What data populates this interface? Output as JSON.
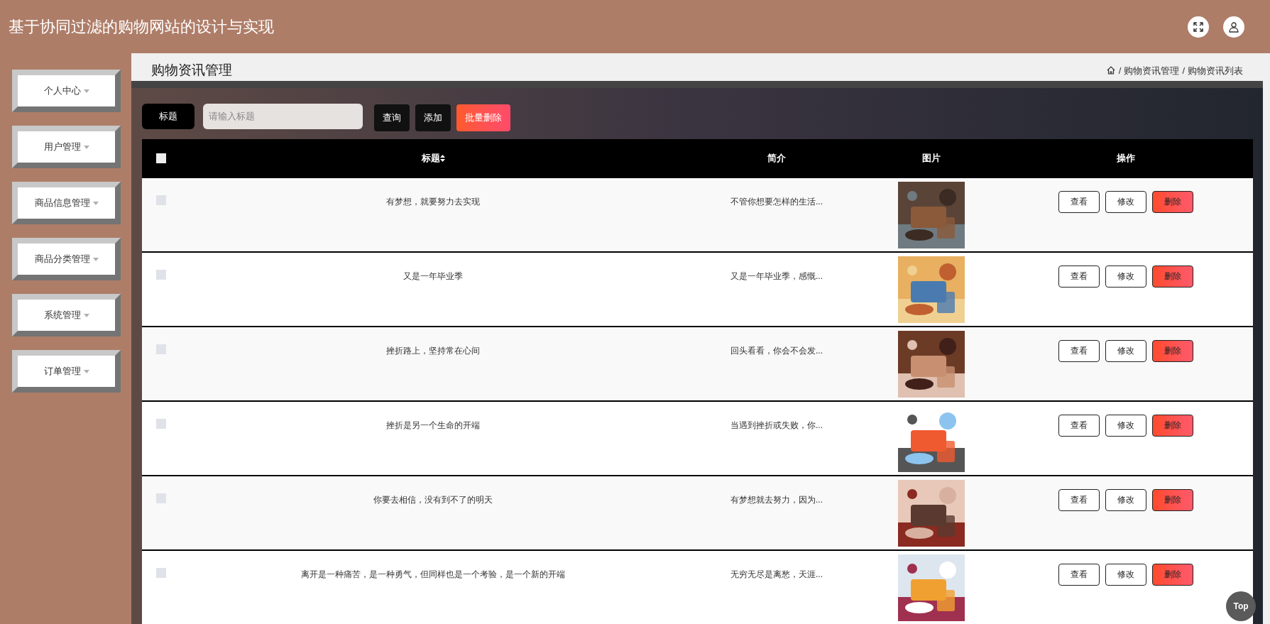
{
  "header": {
    "title": "基于协同过滤的购物网站的设计与实现"
  },
  "sidebar": {
    "items": [
      {
        "label": "个人中心",
        "selected": false
      },
      {
        "label": "用户管理",
        "selected": false
      },
      {
        "label": "商品信息管理",
        "selected": false
      },
      {
        "label": "商品分类管理",
        "selected": false
      },
      {
        "label": "系统管理",
        "selected": false
      },
      {
        "label": "订单管理",
        "selected": false
      }
    ]
  },
  "page": {
    "title": "购物资讯管理",
    "breadcrumb_separator": "/",
    "breadcrumb": [
      "购物资讯管理",
      "购物资讯列表"
    ]
  },
  "search": {
    "label": "标题",
    "placeholder": "请输入标题",
    "buttons": [
      {
        "label": "查询",
        "kind": "dark"
      },
      {
        "label": "添加",
        "kind": "dark"
      },
      {
        "label": "批量删除",
        "kind": "danger"
      }
    ]
  },
  "table": {
    "header_checked": false,
    "columns": [
      "标题",
      "简介",
      "图片",
      "操作"
    ],
    "rows": [
      {
        "checked": false,
        "title": "有梦想，就要努力去实现",
        "intro": "不管你想要怎样的生活...",
        "image": {
          "kind": "picture"
        },
        "actions": [
          "查看",
          "修改",
          "删除"
        ]
      },
      {
        "checked": false,
        "title": "又是一年毕业季",
        "intro": "又是一年毕业季，感慨...",
        "image": {
          "kind": "picture"
        },
        "actions": [
          "查看",
          "修改",
          "删除"
        ]
      },
      {
        "checked": false,
        "title": "挫折路上，坚持常在心间",
        "intro": "回头看看，你会不会发...",
        "image": {
          "kind": "picture"
        },
        "actions": [
          "查看",
          "修改",
          "删除"
        ]
      },
      {
        "checked": false,
        "title": "挫折是另一个生命的开端",
        "intro": "当遇到挫折或失败，你...",
        "image": {
          "kind": "picture"
        },
        "actions": [
          "查看",
          "修改",
          "删除"
        ]
      },
      {
        "checked": false,
        "title": "你要去相信，没有到不了的明天",
        "intro": "有梦想就去努力，因为...",
        "image": {
          "kind": "picture"
        },
        "actions": [
          "查看",
          "修改",
          "删除"
        ]
      },
      {
        "checked": false,
        "title": "离开是一种痛苦，是一种勇气，但同样也是一个考验，是一个新的开端",
        "intro": "无穷无尽是离愁，天涯...",
        "image": {
          "kind": "picture"
        },
        "actions": [
          "查看",
          "修改",
          "删除"
        ]
      }
    ]
  },
  "back_to_top": "Top"
}
